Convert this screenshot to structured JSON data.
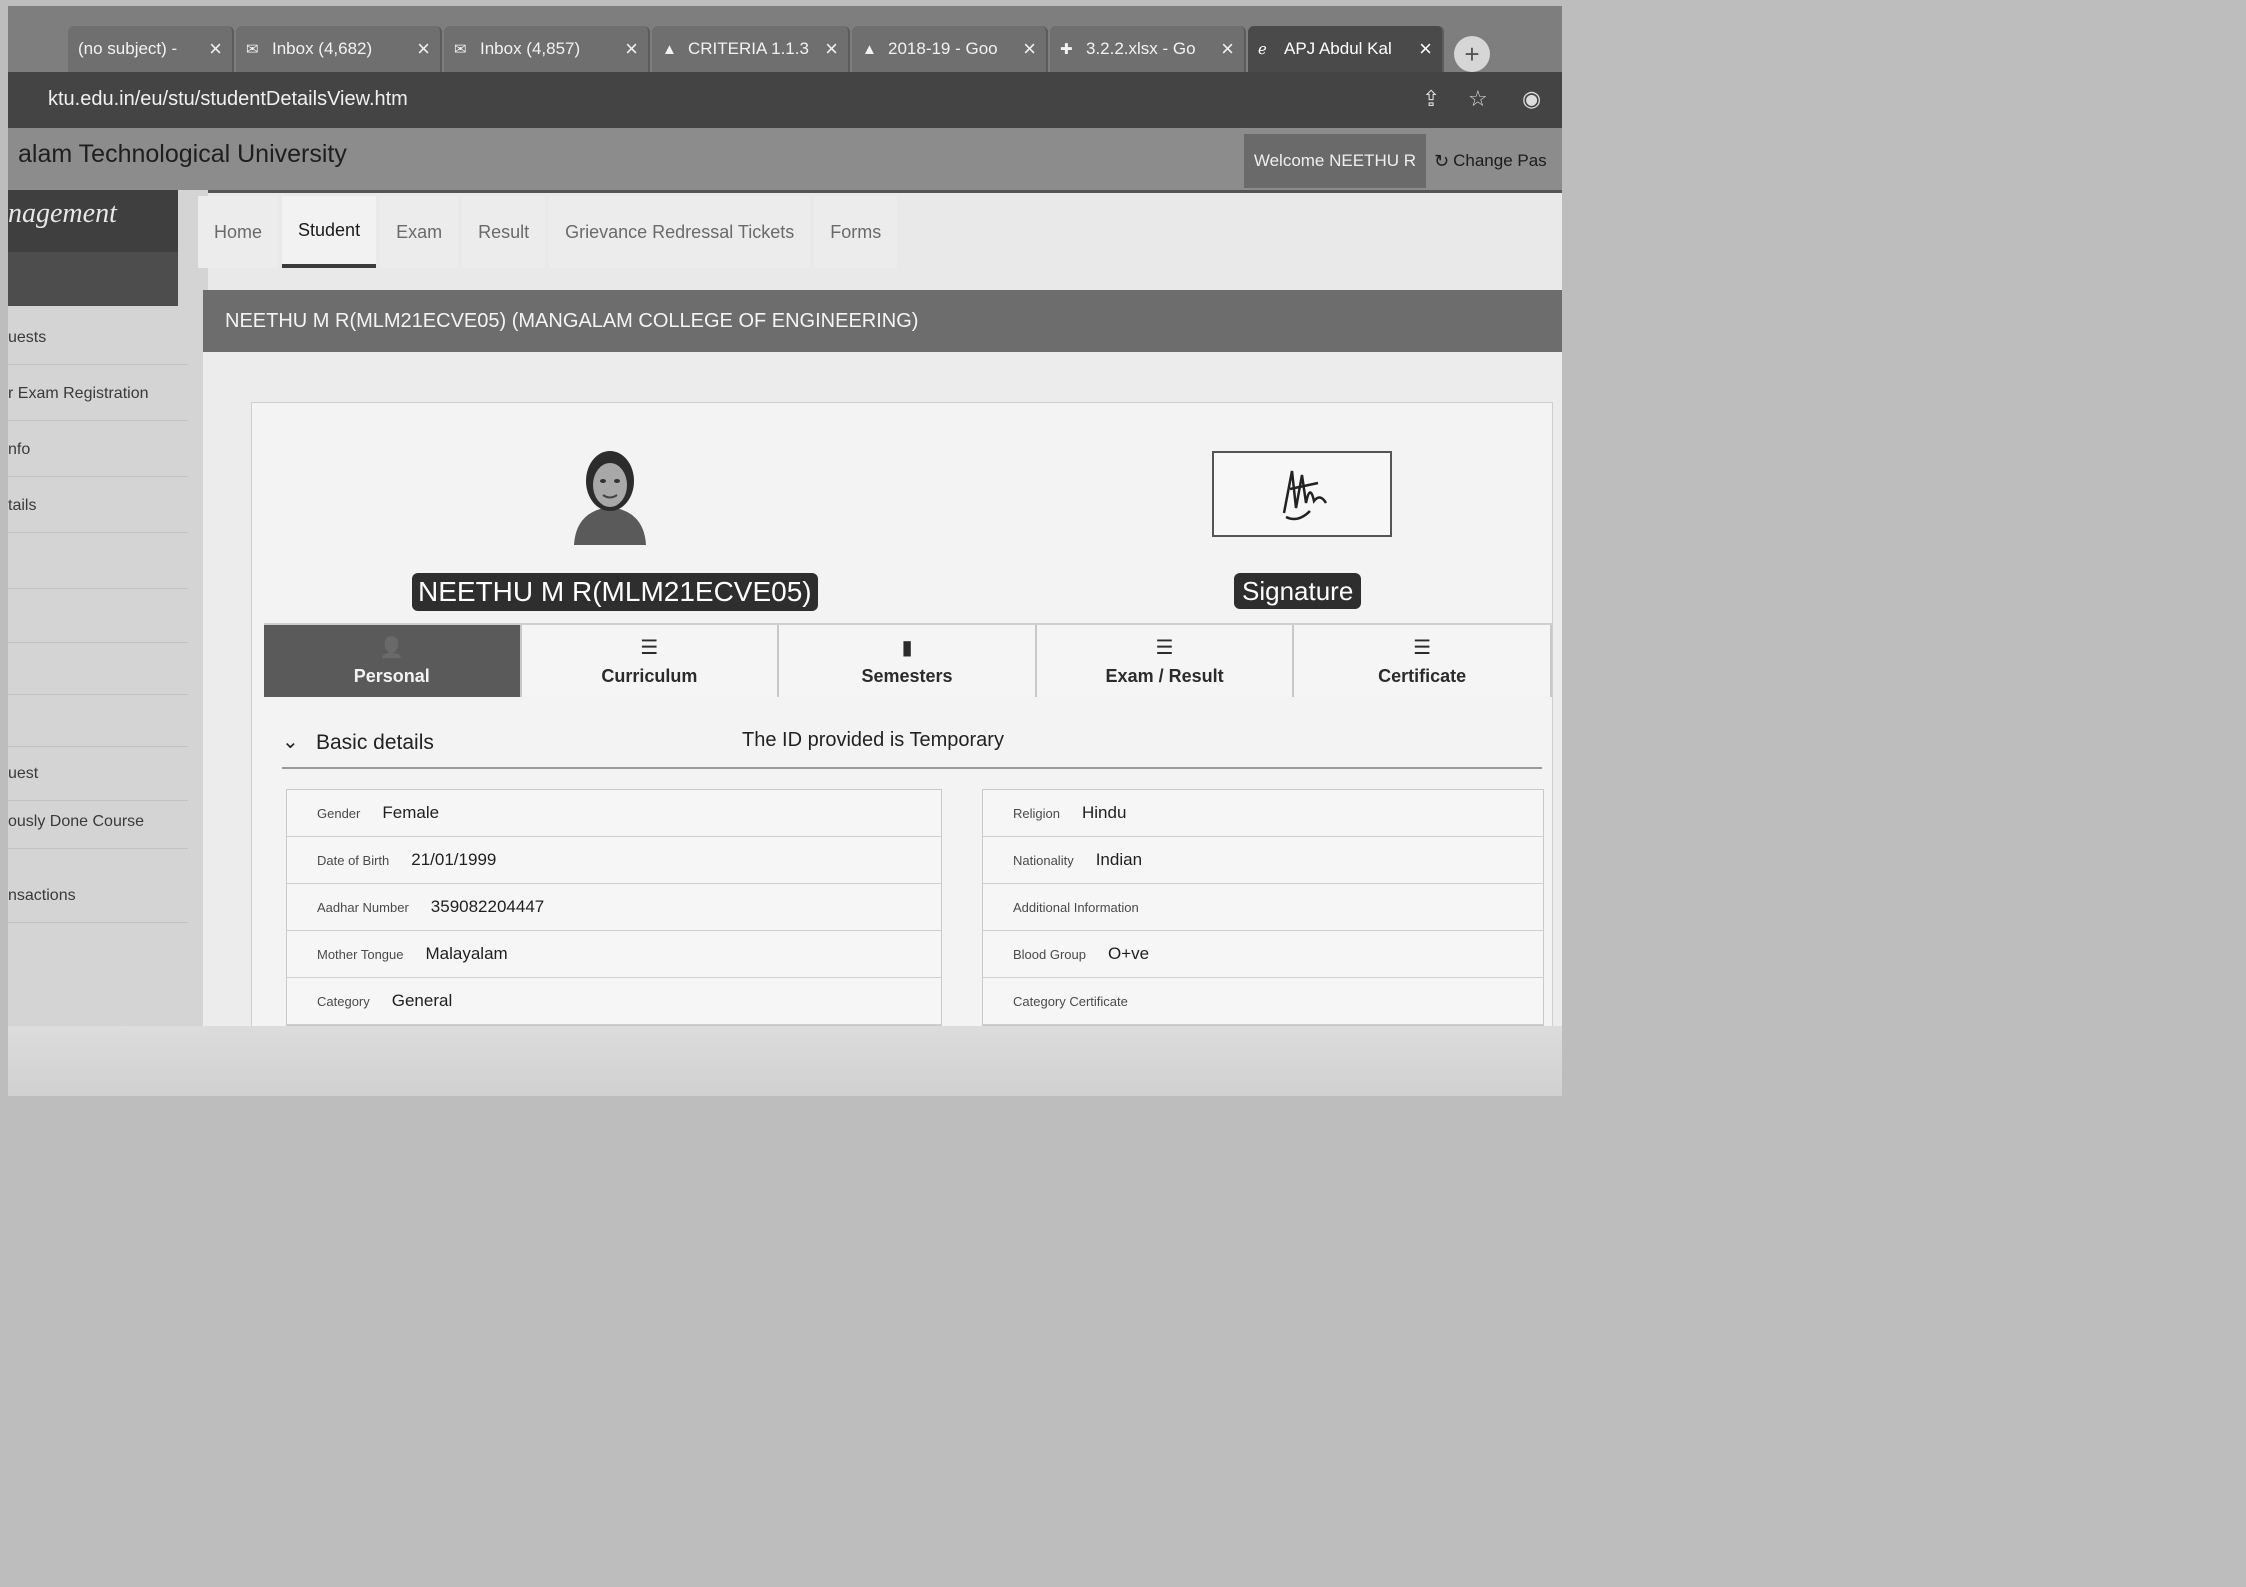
{
  "browser": {
    "tabs": [
      {
        "title": "(no subject) -",
        "active": false
      },
      {
        "title": "Inbox (4,682)",
        "active": false
      },
      {
        "title": "Inbox (4,857)",
        "active": false
      },
      {
        "title": "CRITERIA 1.1.3",
        "active": false
      },
      {
        "title": "2018-19 - Goo",
        "active": false
      },
      {
        "title": "3.2.2.xlsx - Go",
        "active": false
      },
      {
        "title": "APJ Abdul Kal",
        "active": true
      }
    ],
    "close_glyph": "×",
    "new_tab_glyph": "+",
    "url": "ktu.edu.in/eu/stu/studentDetailsView.htm"
  },
  "site": {
    "title": "alam Technological University",
    "welcome": "Welcome NEETHU R",
    "change_password": "Change Pas"
  },
  "sidebar": {
    "brand": "nagement",
    "items": [
      "uests",
      "r Exam Registration",
      "nfo",
      "tails",
      "",
      "",
      "",
      "",
      "uest",
      "ously Done Course",
      "nsactions"
    ]
  },
  "nav": {
    "items": [
      "Home",
      "Student",
      "Exam",
      "Result",
      "Grievance Redressal Tickets",
      "Forms"
    ],
    "active": "Student"
  },
  "panel": {
    "heading": "NEETHU M R(MLM21ECVE05) (MANGALAM COLLEGE OF ENGINEERING)"
  },
  "profile": {
    "name_id": "NEETHU M R(MLM21ECVE05)",
    "signature_label": "Signature"
  },
  "detail_tabs": [
    {
      "label": "Personal",
      "icon": "user-icon",
      "active": true
    },
    {
      "label": "Curriculum",
      "icon": "list-icon",
      "active": false
    },
    {
      "label": "Semesters",
      "icon": "book-icon",
      "active": false
    },
    {
      "label": "Exam / Result",
      "icon": "list-icon",
      "active": false
    },
    {
      "label": "Certificate",
      "icon": "list-icon",
      "active": false
    }
  ],
  "basic": {
    "title": "Basic details",
    "note": "The ID provided is Temporary",
    "left": [
      {
        "label": "Gender",
        "value": "Female"
      },
      {
        "label": "Date of Birth",
        "value": "21/01/1999"
      },
      {
        "label": "Aadhar Number",
        "value": "359082204447"
      },
      {
        "label": "Mother Tongue",
        "value": "Malayalam"
      },
      {
        "label": "Category",
        "value": "General"
      }
    ],
    "right": [
      {
        "label": "Religion",
        "value": "Hindu"
      },
      {
        "label": "Nationality",
        "value": "Indian"
      },
      {
        "label": "Additional Information",
        "value": ""
      },
      {
        "label": "Blood Group",
        "value": "O+ve"
      },
      {
        "label": "Category Certificate",
        "value": ""
      }
    ]
  }
}
